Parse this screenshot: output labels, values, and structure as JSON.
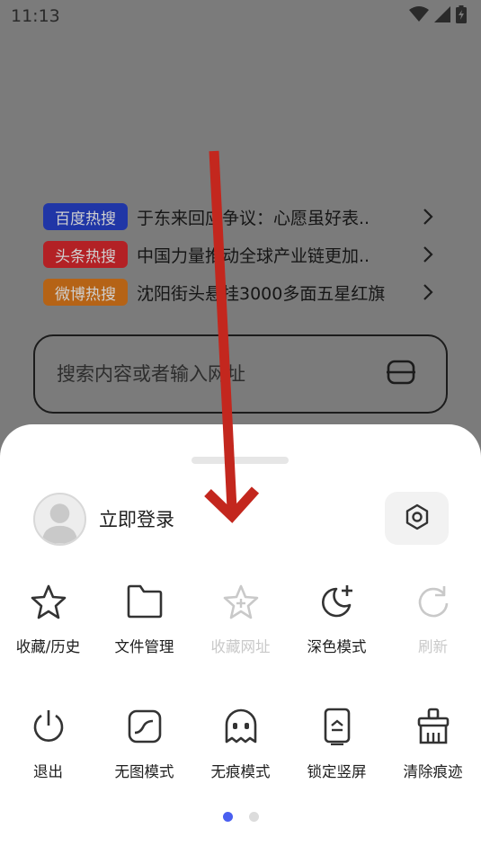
{
  "status_bar": {
    "time": "11:13",
    "icons": [
      "wifi-icon",
      "cellular-signal-icon",
      "battery-charging-icon"
    ]
  },
  "hot_lists": [
    {
      "badge": "百度热搜",
      "badge_color": "#2036a6",
      "text": "于东来回应争议：心愿虽好表.."
    },
    {
      "badge": "头条热搜",
      "badge_color": "#b32125",
      "text": "中国力量推动全球产业链更加.."
    },
    {
      "badge": "微博热搜",
      "badge_color": "#b56316",
      "text": "沈阳街头悬挂3000多面五星红旗"
    }
  ],
  "search": {
    "placeholder": "搜索内容或者输入网址",
    "scan_icon": "scan-icon"
  },
  "sheet": {
    "login_label": "立即登录",
    "settings_icon": "gear-icon",
    "menu_row_1": [
      {
        "label": "收藏/历史",
        "icon": "star-icon",
        "enabled": true
      },
      {
        "label": "文件管理",
        "icon": "folder-icon",
        "enabled": true
      },
      {
        "label": "收藏网址",
        "icon": "star-plus-icon",
        "enabled": false
      },
      {
        "label": "深色模式",
        "icon": "moon-icon",
        "enabled": true
      },
      {
        "label": "刷新",
        "icon": "refresh-icon",
        "enabled": false
      }
    ],
    "menu_row_2": [
      {
        "label": "退出",
        "icon": "power-icon",
        "enabled": true
      },
      {
        "label": "无图模式",
        "icon": "no-image-icon",
        "enabled": true
      },
      {
        "label": "无痕模式",
        "icon": "ghost-icon",
        "enabled": true
      },
      {
        "label": "锁定竖屏",
        "icon": "lock-portrait-icon",
        "enabled": true
      },
      {
        "label": "清除痕迹",
        "icon": "broom-icon",
        "enabled": true
      }
    ],
    "page_count": 2,
    "active_page": 1
  },
  "colors": {
    "annotation_arrow": "#c3271e",
    "page_dot_active": "#4a5ff0",
    "overlay": "#7b7b7b"
  }
}
